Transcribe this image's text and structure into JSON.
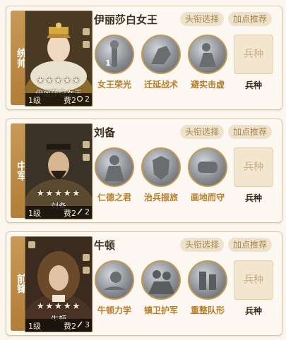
{
  "buttons": {
    "avatar_select": "头衔选择",
    "points_recommend": "加点推荐"
  },
  "arms": {
    "slot_text": "兵种",
    "label": "兵种"
  },
  "panels": [
    {
      "role": "统帅",
      "hero": "伊丽莎白女王",
      "portrait_name": "伊丽莎白女王",
      "stars": "★★★★★",
      "level": "1级",
      "cost": "费2",
      "count": "2",
      "skills": [
        {
          "name": "女王荣光",
          "icon": "queen-statue-icon",
          "level": "1"
        },
        {
          "name": "迁延战术",
          "icon": "knight-horse-icon",
          "level": ""
        },
        {
          "name": "避实击虚",
          "icon": "soldier-icon",
          "level": ""
        }
      ]
    },
    {
      "role": "中军",
      "hero": "刘备",
      "portrait_name": "刘备",
      "stars": "★★★★★",
      "level": "1级",
      "cost": "费2",
      "count": "2",
      "skills": [
        {
          "name": "仁德之君",
          "icon": "emperor-statue-icon",
          "level": ""
        },
        {
          "name": "治兵振旅",
          "icon": "warrior-shield-icon",
          "level": ""
        },
        {
          "name": "画地而守",
          "icon": "fist-icon",
          "level": ""
        }
      ]
    },
    {
      "role": "前锋",
      "hero": "牛顿",
      "portrait_name": "牛顿",
      "stars": "★★★★★",
      "level": "1级",
      "cost": "费2",
      "count": "3",
      "skills": [
        {
          "name": "牛顿力学",
          "icon": "apple-hand-icon",
          "level": ""
        },
        {
          "name": "镇卫护军",
          "icon": "guard-icon",
          "level": ""
        },
        {
          "name": "重整队形",
          "icon": "formation-icon",
          "level": ""
        }
      ]
    }
  ]
}
